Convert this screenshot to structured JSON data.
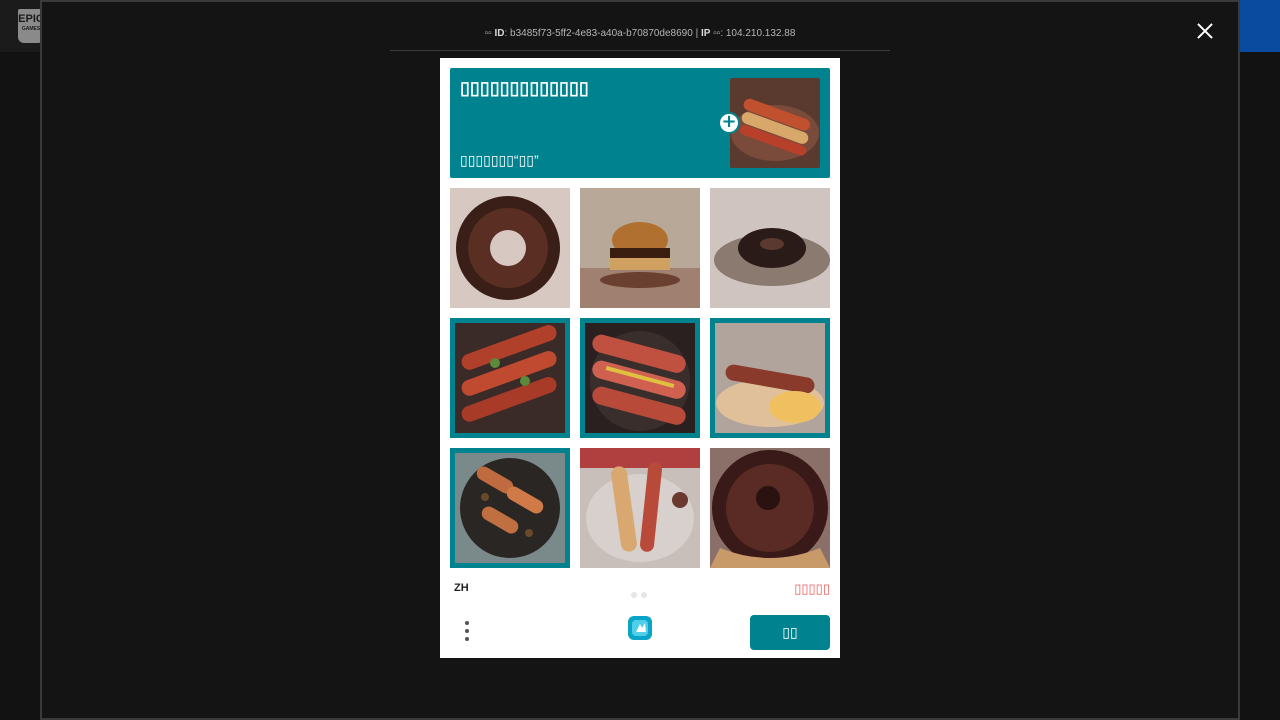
{
  "background": {
    "logo_text": "EPIC",
    "logo_subtext": "GAMES"
  },
  "modal": {
    "meta": {
      "id_prefix": "▫▫",
      "id_label": "ID",
      "id_value": "b3485f73-5ff2-4e83-a40a-b70870de8690",
      "separator": "|",
      "ip_label": "IP",
      "ip_prefix": "▫▫",
      "ip_value": "104.210.132.88"
    }
  },
  "captcha": {
    "prompt_title": "▯▯▯▯▯▯▯▯▯▯▯▯▯",
    "prompt_sub": "▯▯▯▯▯▯▯“▯▯”",
    "plus_label": "+",
    "tiles": [
      {
        "subject": "chocolate donut",
        "selected": false
      },
      {
        "subject": "burger",
        "selected": false
      },
      {
        "subject": "donut on plate",
        "selected": false
      },
      {
        "subject": "hot dogs with herbs",
        "selected": true
      },
      {
        "subject": "hot dogs with mustard",
        "selected": true
      },
      {
        "subject": "sausage in bun",
        "selected": true
      },
      {
        "subject": "hot dogs platter",
        "selected": true
      },
      {
        "subject": "hot dogs on tray",
        "selected": false
      },
      {
        "subject": "chocolate donut close-up",
        "selected": false
      }
    ],
    "language": "ZH",
    "error_text": "▯▯▯▯▯",
    "check_label": "▯▯"
  },
  "colors": {
    "accent": "#00838f",
    "error": "#e85a5a"
  }
}
